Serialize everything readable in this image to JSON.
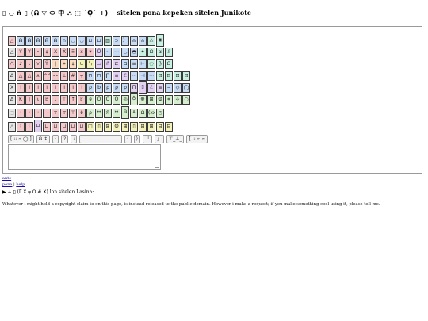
{
  "header": {
    "glyphs": "▯ ◡ ǹ ▯ (ᕱ ▽ ⬭ 中 ⛬ ⬚ ˙Ọ˙ +)",
    "title": "sitelen pona kepeken sitelen Junikote"
  },
  "keyboard": {
    "rows": [
      [
        [
          "△",
          "c1"
        ],
        [
          "ᕱ",
          "c3"
        ],
        [
          "ᕱ",
          "c3"
        ],
        [
          "ᕱ",
          "c3"
        ],
        [
          "ᕱ",
          "c3"
        ],
        [
          "ᕱ",
          "c3"
        ],
        [
          "∩",
          "c3"
        ],
        [
          "◡",
          "c3"
        ],
        [
          "◡",
          "c3"
        ],
        [
          "⊔",
          "c3"
        ],
        [
          "⊔",
          "c3"
        ],
        [
          "▥",
          "c4"
        ],
        [
          "⊃",
          "c3"
        ],
        [
          "〉",
          "c3"
        ],
        [
          "⍝",
          "c3"
        ],
        [
          "⍝",
          "c3"
        ],
        [
          "ஃ",
          "c4"
        ],
        [
          "◉",
          "c4"
        ]
      ],
      [
        [
          "△",
          "c0"
        ],
        [
          "Y",
          "c1"
        ],
        [
          "Y",
          "c1"
        ],
        [
          "ᵕ",
          "c1"
        ],
        [
          "⍋",
          "c1"
        ],
        [
          "X",
          "c1"
        ],
        [
          "Ẋ",
          "c1"
        ],
        [
          "⠿",
          "c1"
        ],
        [
          "x",
          "c1"
        ],
        [
          "✶",
          "c1"
        ],
        [
          "Ů",
          "c2"
        ],
        [
          "∼",
          "c3"
        ],
        [
          "⋯",
          "c3"
        ],
        [
          "◡",
          "c3"
        ],
        [
          "◓",
          "c3"
        ],
        [
          "✦",
          "c4"
        ],
        [
          "ᘯ",
          "c4"
        ],
        [
          "α",
          "c4"
        ],
        [
          "ℰ",
          "c4"
        ]
      ],
      [
        [
          "ᗅ",
          "c1"
        ],
        [
          "♪",
          "c1"
        ],
        [
          "⍳",
          "c1"
        ],
        [
          "⋎",
          "c1"
        ],
        [
          "Ÿ",
          "c1"
        ],
        [
          "∣",
          "c6"
        ],
        [
          "⌗",
          "c6"
        ],
        [
          "⍋",
          "c6"
        ],
        [
          "∟",
          "c5"
        ],
        [
          "ㄣ",
          "c5"
        ],
        [
          "▭",
          "c2"
        ],
        [
          "ǹ",
          "c2"
        ],
        [
          "⊏",
          "c2"
        ],
        [
          "⊐",
          "c3"
        ],
        [
          "≡",
          "c3"
        ],
        [
          "⊢",
          "c3"
        ],
        [
          "◌",
          "c4"
        ],
        [
          "ℨ",
          "c4"
        ],
        [
          "ᘯ",
          "c4"
        ]
      ],
      [
        [
          "Δ",
          "c0"
        ],
        [
          "△",
          "c1"
        ],
        [
          "△",
          "c1"
        ],
        [
          "∧",
          "c1"
        ],
        [
          "⌃⌃",
          "c1"
        ],
        [
          "⋆⋆",
          "c1"
        ],
        [
          "⊥",
          "c1"
        ],
        [
          "#",
          "c1"
        ],
        [
          "╤",
          "c1"
        ],
        [
          "⊓",
          "c3"
        ],
        [
          "⊓",
          "c3"
        ],
        [
          "∏",
          "c3"
        ],
        [
          "≡",
          "c2"
        ],
        [
          "ℰ",
          "c2"
        ],
        [
          "⋯",
          "c3"
        ],
        [
          "⊣",
          "c3"
        ],
        [
          "⋯",
          "c3"
        ],
        [
          "⊡",
          "c4"
        ],
        [
          "⊡",
          "c4"
        ],
        [
          "⊡",
          "c4"
        ],
        [
          "⊡",
          "c4"
        ]
      ],
      [
        [
          "X",
          "c0"
        ],
        [
          "↑",
          "c1"
        ],
        [
          "↑",
          "c1"
        ],
        [
          "↑",
          "c1"
        ],
        [
          "↑",
          "c1"
        ],
        [
          "↑",
          "c1"
        ],
        [
          "↑",
          "c1"
        ],
        [
          "↑",
          "c1"
        ],
        [
          "↑",
          "c1"
        ],
        [
          "ρ",
          "c3"
        ],
        [
          "b",
          "c3"
        ],
        [
          "ρ",
          "c3"
        ],
        [
          "ρ",
          "c3"
        ],
        [
          "ρ",
          "c3"
        ],
        [
          "П",
          "c2"
        ],
        [
          "▯",
          "c2"
        ],
        [
          "ℰ",
          "c2"
        ],
        [
          "≡",
          "c2"
        ],
        [
          "−",
          "c3"
        ],
        [
          "◇",
          "c3"
        ],
        [
          "◯",
          "c3"
        ]
      ],
      [
        [
          "Δ",
          "c0"
        ],
        [
          "K",
          "c1"
        ],
        [
          "∣",
          "c1"
        ],
        [
          "⍳",
          "c1"
        ],
        [
          "♇",
          "c1"
        ],
        [
          "⍳",
          "c1"
        ],
        [
          "⊤",
          "c1"
        ],
        [
          "↑",
          "c1"
        ],
        [
          "♇",
          "c1"
        ],
        [
          "⍬",
          "c7"
        ],
        [
          "Ö",
          "c7"
        ],
        [
          "Ö",
          "c7"
        ],
        [
          "Ö",
          "c7"
        ],
        [
          "◎",
          "c7"
        ],
        [
          "♁",
          "c7"
        ],
        [
          "☸",
          "c7"
        ],
        [
          "⊞",
          "c7"
        ],
        [
          "ⵀ",
          "c7"
        ],
        [
          "⌗",
          "c7"
        ],
        [
          "⊹",
          "c7"
        ],
        [
          "○",
          "c7"
        ]
      ],
      [
        [
          "⬚",
          "c0"
        ],
        [
          "∸",
          "c1"
        ],
        [
          "∸",
          "c1"
        ],
        [
          "∸",
          "c1"
        ],
        [
          "→",
          "c1"
        ],
        [
          "∓",
          "c1"
        ],
        [
          "∓",
          "c1"
        ],
        [
          "⊤",
          "c1"
        ],
        [
          "⍬",
          "c1"
        ],
        [
          "ρ",
          "c7"
        ],
        [
          "ᕯ",
          "c7"
        ],
        [
          "ᘝ",
          "c7"
        ],
        [
          "ᕯ",
          "c7"
        ],
        [
          "ᕱ",
          "c7"
        ],
        [
          "ᐞ",
          "c7"
        ],
        [
          "Ω",
          "c7"
        ],
        [
          "(xx)",
          "c7"
        ],
        [
          "◷",
          "c7"
        ]
      ],
      [
        [
          "△",
          "c0"
        ],
        [
          "⋮",
          "c1"
        ],
        [
          "⋮",
          "c1"
        ],
        [
          "⊔",
          "c2"
        ],
        [
          "⊔",
          "c1"
        ],
        [
          "⊔",
          "c1"
        ],
        [
          "⊔",
          "c1"
        ],
        [
          "⊔",
          "c1"
        ],
        [
          "⊔",
          "c1"
        ],
        [
          "□",
          "c5"
        ],
        [
          "▯",
          "c5"
        ],
        [
          "⊞",
          "c5"
        ],
        [
          "ⵀ",
          "c5"
        ],
        [
          "⊞",
          "c5"
        ],
        [
          "▯",
          "c5"
        ],
        [
          "⊞",
          "c5"
        ],
        [
          "⊞",
          "c5"
        ],
        [
          "⊟",
          "c5"
        ],
        [
          "⊟",
          "c5"
        ]
      ]
    ]
  },
  "toolbar": {
    "btn1": "[ :: » ◯ ]",
    "btn2": "ᕱ ↕",
    "btn3": "·",
    "btn4": "?",
    "btn5": ":",
    "btn6": "(",
    "btn7": ")",
    "btn8": "「",
    "btn9": "」",
    "btn10": "⊤_⊥_",
    "btn11": "[ :: » ∞"
  },
  "textarea": {
    "value": ""
  },
  "links": {
    "ante": "ante",
    "pona": "pona",
    "sep": " | ",
    "help": "help"
  },
  "footer": {
    "glyph_line": "▶ ∸ ▯ (ᒥ X ╤ O # X)",
    "suffix": " lon sitelen Lasina:",
    "paragraph": "Whatever i might hold a copyright claim to on this page, is instead released to the public domain. However i make a request; if you make something cool using it, please tell me."
  }
}
